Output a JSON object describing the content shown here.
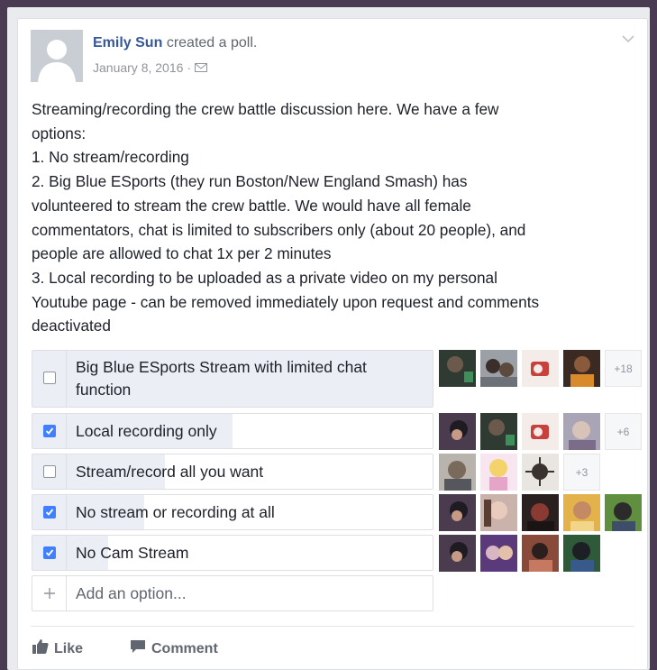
{
  "post": {
    "author": "Emily Sun",
    "action": "created a poll.",
    "date": "January 8, 2016",
    "privacy_separator": "·",
    "privacy_icon": "envelope-icon",
    "body_lines": [
      "Streaming/recording the crew battle discussion here. We have a few",
      "options:",
      "1. No stream/recording",
      "2. Big Blue ESports (they run Boston/New England Smash) has",
      "volunteered to stream the crew battle. We would have all female",
      "commentators, chat is limited to subscribers only (about 20 people), and",
      "people are allowed to chat 1x per 2 minutes",
      "3. Local recording to be uploaded as a private video on my personal",
      "Youtube page - can be removed immediately upon request and comments",
      "deactivated"
    ]
  },
  "poll": {
    "options": [
      {
        "label_lines": [
          "Big Blue ESports Stream with limited chat",
          "function"
        ],
        "checked": false,
        "fill_fraction": 1.0,
        "more": "+18"
      },
      {
        "label_lines": [
          "Local recording only"
        ],
        "checked": true,
        "fill_fraction": 0.5,
        "more": "+6"
      },
      {
        "label_lines": [
          "Stream/record all you want"
        ],
        "checked": false,
        "fill_fraction": 0.33,
        "more": "+3"
      },
      {
        "label_lines": [
          "No stream or recording at all"
        ],
        "checked": true,
        "fill_fraction": 0.28,
        "more": ""
      },
      {
        "label_lines": [
          "No Cam Stream"
        ],
        "checked": true,
        "fill_fraction": 0.19,
        "more": ""
      }
    ],
    "add_option_placeholder": "Add an option..."
  },
  "actions": {
    "like": "Like",
    "comment": "Comment"
  },
  "colors": {
    "link": "#365899",
    "accent": "#4080ff",
    "vote_fill": "#ebeef5"
  }
}
